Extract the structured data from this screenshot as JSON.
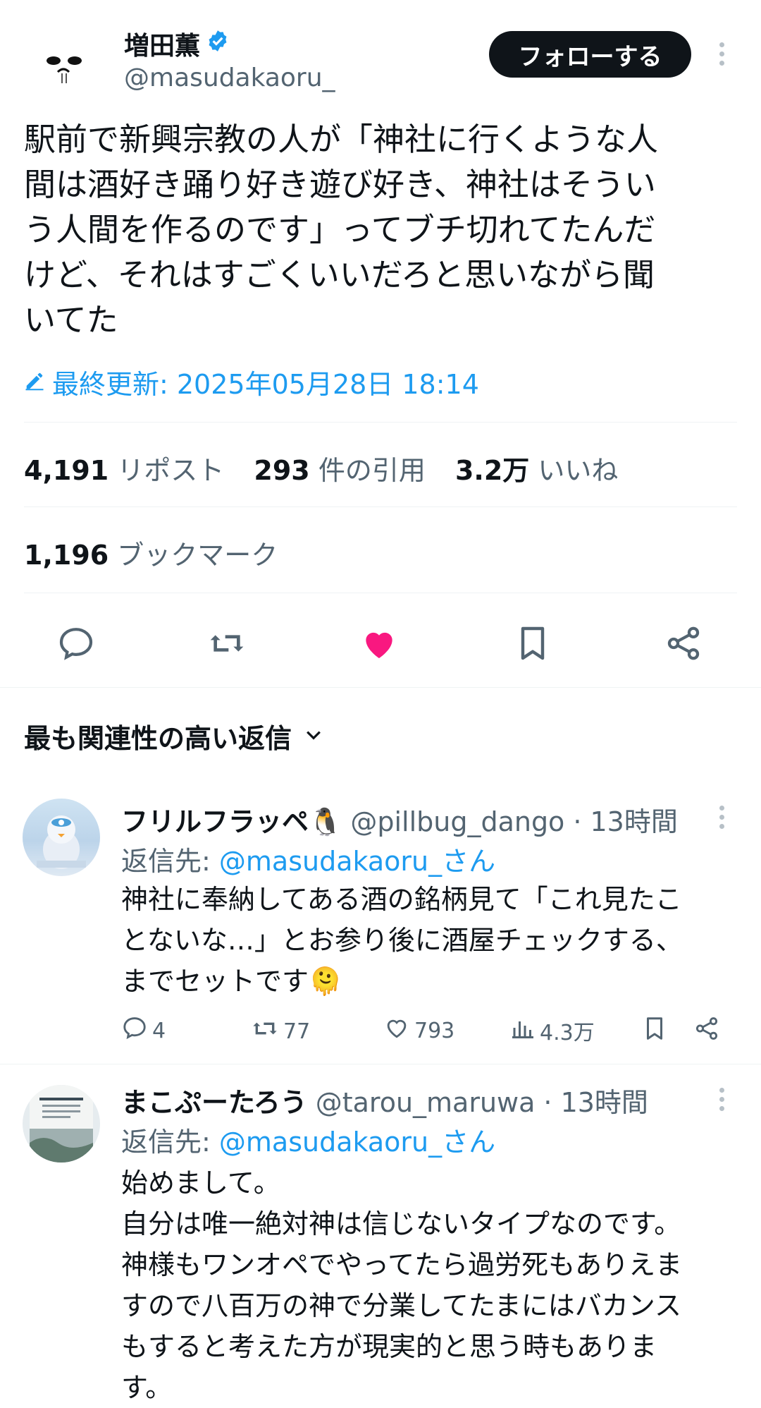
{
  "tweet": {
    "author_name": "増田薫",
    "author_handle": "@masudakaoru_",
    "follow_label": "フォローする",
    "text_lines": [
      "駅前で新興宗教の人が「神社に行くような人",
      "間は酒好き踊り好き遊び好き、神社はそうい",
      "う人間を作るのです」ってブチ切れてたんだ",
      "けど、それはすごくいいだろと思いながら聞",
      "いてた"
    ],
    "edited_label": "最終更新: 2025年05月28日 18:14",
    "reposts_count": "4,191",
    "reposts_label": "リポスト",
    "quotes_count": "293",
    "quotes_label": "件の引用",
    "likes_count": "3.2万",
    "likes_label": "いいね",
    "bookmarks_count": "1,196",
    "bookmarks_label": "ブックマーク"
  },
  "replies_sort": {
    "label": "最も関連性の高い返信"
  },
  "replies": [
    {
      "name": "フリルフラッペ🐧",
      "handle": "@pillbug_dango",
      "time": "· 13時間",
      "reply_to_prefix": "返信先:",
      "reply_to_handle": "@masudakaoru_さん",
      "text_lines": [
        "神社に奉納してある酒の銘柄見て「これ見たこ",
        "とないな…」とお参り後に酒屋チェックする、",
        "までセットです🫠"
      ],
      "replies": "4",
      "reposts": "77",
      "likes": "793",
      "views": "4.3万"
    },
    {
      "name": "まこぷーたろう",
      "handle": "@tarou_maruwa",
      "time": "· 13時間",
      "reply_to_prefix": "返信先:",
      "reply_to_handle": "@masudakaoru_さん",
      "text_lines": [
        "始めまして。",
        "自分は唯一絶対神は信じないタイプなのです。",
        "神様もワンオペでやってたら過労死もありえま",
        "すので八百万の神で分業してたまにはバカンス",
        "もすると考えた方が現実的と思う時もありま",
        "す。"
      ]
    }
  ],
  "colors": {
    "accent": "#1d9bf0",
    "like": "#f91880",
    "text": "#0f1419",
    "muted": "#536471"
  }
}
